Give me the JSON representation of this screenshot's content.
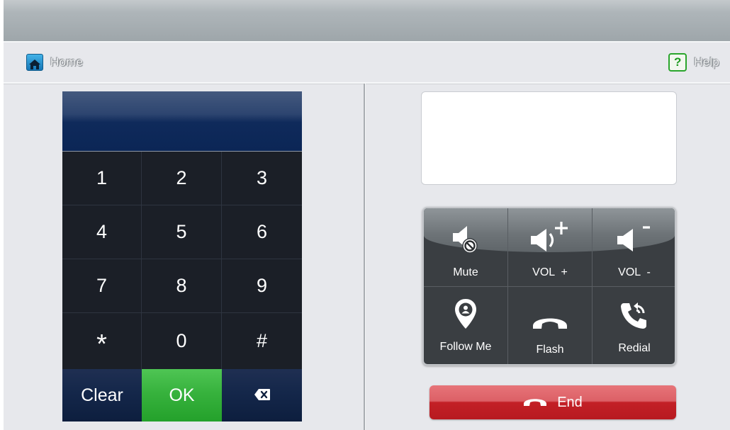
{
  "nav": {
    "home_label": "Home",
    "help_label": "Help",
    "help_glyph": "?"
  },
  "keypad": {
    "display_value": "",
    "keys": [
      "1",
      "2",
      "3",
      "4",
      "5",
      "6",
      "7",
      "8",
      "9",
      "*",
      "0",
      "#"
    ],
    "clear_label": "Clear",
    "ok_label": "OK",
    "delete_icon": "backspace-icon"
  },
  "call_info": {
    "text": ""
  },
  "functions": {
    "mute": {
      "label": "Mute",
      "icon": "mute-icon"
    },
    "vol_up": {
      "label": "VOL  +",
      "icon": "volume-up-icon"
    },
    "vol_down": {
      "label": "VOL  -",
      "icon": "volume-down-icon"
    },
    "follow_me": {
      "label": "Follow Me",
      "icon": "follow-me-icon"
    },
    "flash": {
      "label": "Flash",
      "icon": "flash-handset-icon"
    },
    "redial": {
      "label": "Redial",
      "icon": "redial-icon"
    }
  },
  "end_call": {
    "label": "End",
    "icon": "hang-up-icon"
  },
  "colors": {
    "ok_green": "#37b23d",
    "end_red": "#c32026",
    "keypad_bg": "#1b1f27",
    "help_green": "#2aa52c",
    "home_blue": "#1676b6"
  }
}
